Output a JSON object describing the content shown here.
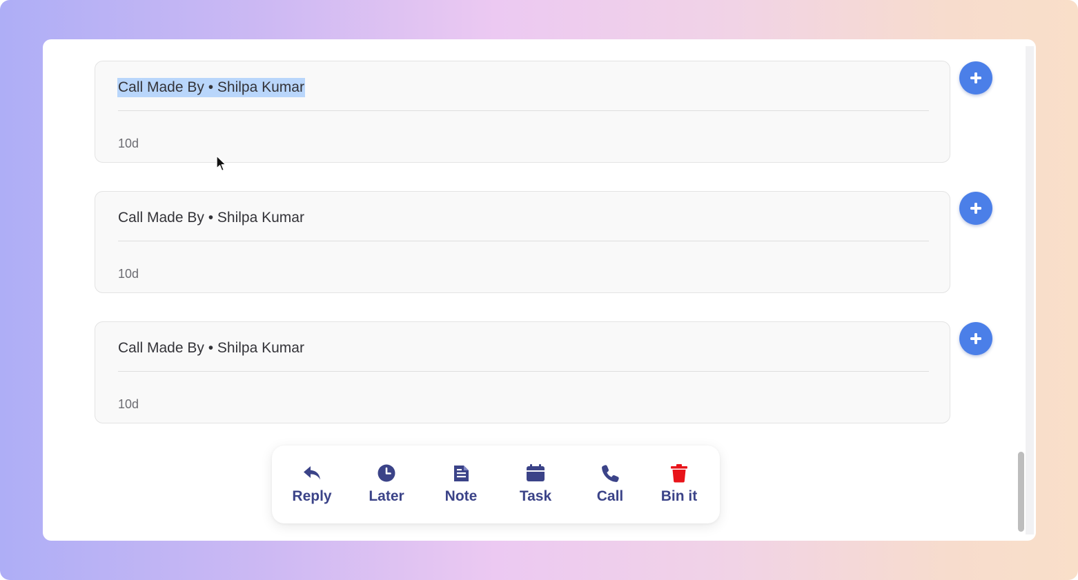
{
  "cards": [
    {
      "title": "Call Made By • Shilpa Kumar",
      "time": "10d",
      "selected": true
    },
    {
      "title": "Call Made By • Shilpa Kumar",
      "time": "10d",
      "selected": false
    },
    {
      "title": "Call Made By • Shilpa Kumar",
      "time": "10d",
      "selected": false
    }
  ],
  "add_button": {
    "icon": "plus-icon"
  },
  "actions": [
    {
      "label": "Reply",
      "icon": "reply-icon"
    },
    {
      "label": "Later",
      "icon": "clock-icon"
    },
    {
      "label": "Note",
      "icon": "note-icon"
    },
    {
      "label": "Task",
      "icon": "calendar-icon"
    },
    {
      "label": "Call",
      "icon": "phone-icon"
    },
    {
      "label": "Bin it",
      "icon": "trash-icon"
    }
  ],
  "colors": {
    "accent": "#4b7fe8",
    "action_icon": "#3b4388",
    "danger": "#e8141a",
    "selection": "#b9d6fb"
  }
}
